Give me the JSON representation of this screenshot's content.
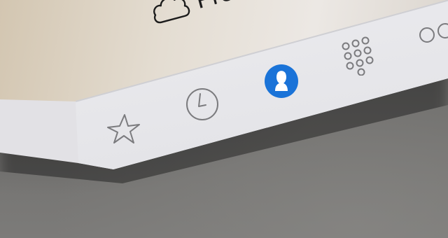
{
  "list_row": {
    "label": "Free Re",
    "icon": "cloud-icon"
  },
  "tab_bar": {
    "active_color": "#1a73d8",
    "inactive_color": "#7b7b7e",
    "tabs": [
      {
        "id": "favorites",
        "icon": "star-icon",
        "active": false
      },
      {
        "id": "recents",
        "icon": "clock-icon",
        "active": false
      },
      {
        "id": "contacts",
        "icon": "contacts-icon",
        "active": true
      },
      {
        "id": "keypad",
        "icon": "keypad-icon",
        "active": false
      },
      {
        "id": "voicemail",
        "icon": "voicemail-icon",
        "active": false
      }
    ]
  }
}
